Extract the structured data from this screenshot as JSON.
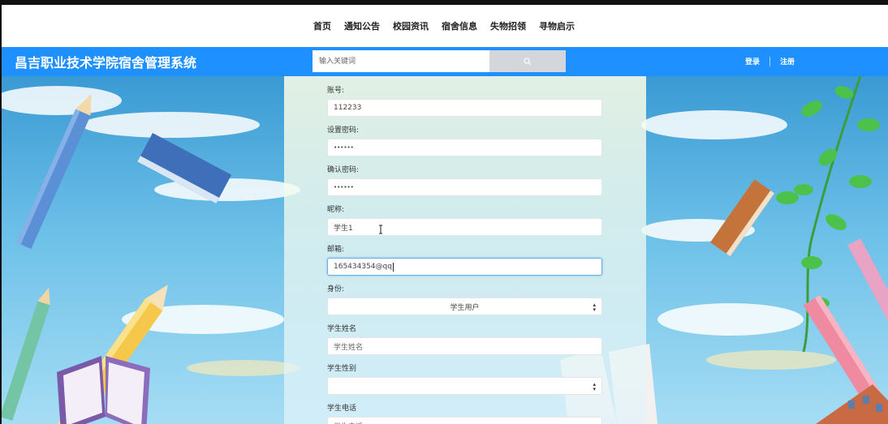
{
  "nav": {
    "items": [
      "首页",
      "通知公告",
      "校园资讯",
      "宿舍信息",
      "失物招领",
      "寻物启示"
    ]
  },
  "header": {
    "title": "昌吉职业技术学院宿舍管理系统",
    "search_placeholder": "输入关键词",
    "login": "登录",
    "register": "注册"
  },
  "form": {
    "account_label": "账号:",
    "account_value": "112233",
    "password_label": "设置密码:",
    "password_value": "••••••",
    "confirm_label": "确认密码:",
    "confirm_value": "••••••",
    "nickname_label": "昵称:",
    "nickname_value": "学生1",
    "email_label": "邮箱:",
    "email_value": "165434354@qq",
    "role_label": "身份:",
    "role_value": "学生用户",
    "name_label": "学生姓名",
    "name_placeholder": "学生姓名",
    "gender_label": "学生性别",
    "gender_value": "",
    "phone_label": "学生电话",
    "phone_placeholder": "学生电话"
  },
  "colors": {
    "header_blue": "#1e90ff",
    "focus_border": "#66afe9"
  }
}
